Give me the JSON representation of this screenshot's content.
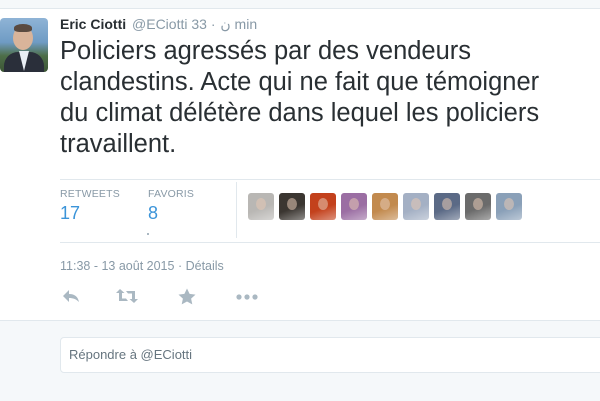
{
  "tweet": {
    "author_name": "Eric Ciotti",
    "author_handle": "@ECiotti",
    "verified_glyph": "ن",
    "separator": "·",
    "relative_time": "33 min",
    "text_lines": [
      "Policiers agressés par des vendeurs",
      "clandestins. Acte qui ne fait que témoigner",
      "du climat délétère dans lequel les policiers",
      "travaillent."
    ]
  },
  "stats": {
    "retweets_label": "RETWEETS",
    "retweets_count": "17",
    "favorites_label": "FAVORIS",
    "favorites_count": "8"
  },
  "favoriters": [
    {
      "icon": "favoriter-avatar-1",
      "color": "#b9b7b4"
    },
    {
      "icon": "favoriter-avatar-2",
      "color": "#3b3631"
    },
    {
      "icon": "favoriter-avatar-3",
      "color": "#c3411c"
    },
    {
      "icon": "favoriter-avatar-4",
      "color": "#9b6ea3"
    },
    {
      "icon": "favoriter-avatar-5",
      "color": "#c28a4e"
    },
    {
      "icon": "favoriter-avatar-6",
      "color": "#a4b0c4"
    },
    {
      "icon": "favoriter-avatar-7",
      "color": "#5b6a86"
    },
    {
      "icon": "favoriter-avatar-8",
      "color": "#6b6b6b"
    },
    {
      "icon": "favoriter-avatar-9",
      "color": "#8aa0b8"
    }
  ],
  "meta": {
    "timestamp": "11:38 - 13 août 2015",
    "separator": "·",
    "details_link": "Détails"
  },
  "actions": [
    {
      "icon": "reply-icon"
    },
    {
      "icon": "retweet-icon"
    },
    {
      "icon": "favorite-star-icon"
    },
    {
      "icon": "more-options-icon"
    }
  ],
  "reply": {
    "placeholder": "Répondre à @ECiotti"
  },
  "colors": {
    "link_blue": "#3b94d9",
    "muted_gray": "#8899a6",
    "action_gray": "#aab8c2",
    "text_dark": "#292f33"
  }
}
